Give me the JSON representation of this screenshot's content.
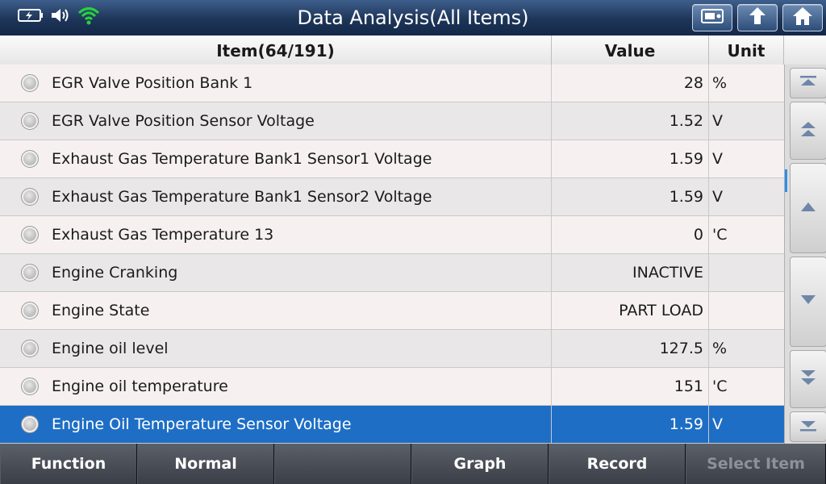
{
  "window": {
    "title": "Data Analysis(All Items)"
  },
  "status_icons": [
    "battery-icon",
    "speaker-icon",
    "wifi-icon"
  ],
  "toolbar_icons": [
    "screenshot-icon",
    "back-icon",
    "home-icon"
  ],
  "table": {
    "headers": {
      "item": "Item(64/191)",
      "value": "Value",
      "unit": "Unit"
    },
    "rows": [
      {
        "item": "EGR Valve Position Bank 1",
        "value": "28",
        "unit": "%"
      },
      {
        "item": "EGR Valve Position Sensor Voltage",
        "value": "1.52",
        "unit": "V"
      },
      {
        "item": "Exhaust Gas Temperature Bank1 Sensor1 Voltage",
        "value": "1.59",
        "unit": "V"
      },
      {
        "item": "Exhaust Gas Temperature Bank1 Sensor2 Voltage",
        "value": "1.59",
        "unit": "V"
      },
      {
        "item": "Exhaust Gas Temperature 13",
        "value": "0",
        "unit": "'C"
      },
      {
        "item": "Engine Cranking",
        "value": "INACTIVE",
        "unit": ""
      },
      {
        "item": "Engine State",
        "value": "PART LOAD",
        "unit": ""
      },
      {
        "item": "Engine oil level",
        "value": "127.5",
        "unit": "%"
      },
      {
        "item": "Engine oil temperature",
        "value": "151",
        "unit": "'C"
      },
      {
        "item": "Engine Oil Temperature Sensor Voltage",
        "value": "1.59",
        "unit": "V"
      }
    ],
    "selected_index": 9
  },
  "scroll_buttons": [
    "scroll-top-icon",
    "page-up-icon",
    "line-up-icon",
    "line-down-icon",
    "page-down-icon",
    "scroll-bottom-icon"
  ],
  "footer": {
    "function": "Function",
    "normal": "Normal",
    "empty": "",
    "graph": "Graph",
    "record": "Record",
    "select_item": "Select Item"
  },
  "colors": {
    "selected_row": "#1e6ec5",
    "titlebar": "#1d3558",
    "wifi": "#27d23c"
  }
}
